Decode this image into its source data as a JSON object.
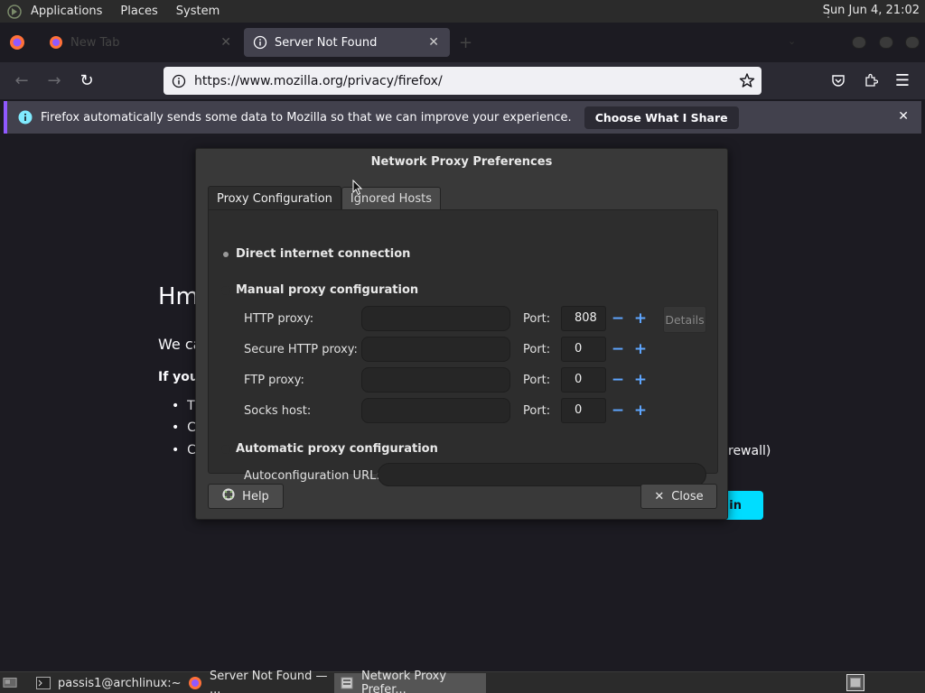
{
  "top_panel": {
    "menu": [
      "Applications",
      "Places",
      "System"
    ],
    "clock": "Sun Jun  4, 21:02"
  },
  "browser": {
    "tabs": [
      {
        "label": "New Tab",
        "active": false
      },
      {
        "label": "Server Not Found",
        "active": true
      }
    ],
    "url": "https://www.mozilla.org/privacy/firefox/",
    "notification": {
      "text": "Firefox automatically sends some data to Mozilla so that we can improve your experience.",
      "button": "Choose What I Share"
    },
    "page": {
      "heading": "Hm",
      "line1": "We ca",
      "line2": "If you",
      "bullets": [
        "T",
        "C",
        "C"
      ],
      "firewall_fragment": "rewall)",
      "button_fragment": "in"
    }
  },
  "dialog": {
    "title": "Network Proxy Preferences",
    "tabs": [
      "Proxy Configuration",
      "Ignored Hosts"
    ],
    "options": {
      "direct": "Direct internet connection",
      "manual": "Manual proxy configuration",
      "automatic": "Automatic proxy configuration"
    },
    "proxies": [
      {
        "label": "HTTP proxy:",
        "port_label": "Port:",
        "port": "808"
      },
      {
        "label": "Secure HTTP proxy:",
        "port_label": "Port:",
        "port": "0"
      },
      {
        "label": "FTP proxy:",
        "port_label": "Port:",
        "port": "0"
      },
      {
        "label": "Socks host:",
        "port_label": "Port:",
        "port": "0"
      }
    ],
    "details_label": "Details",
    "autoconfig_label": "Autoconfiguration URL:",
    "help_label": "Help",
    "close_label": "Close"
  },
  "taskbar": {
    "tasks": [
      {
        "label": "passis1@archlinux:~"
      },
      {
        "label": "Server Not Found — ..."
      },
      {
        "label": "Network Proxy Prefer..."
      }
    ]
  },
  "colors": {
    "accent_cyan": "#00ddff",
    "notification_bar": "#9059ff",
    "spin_button": "#5ea6ff"
  }
}
